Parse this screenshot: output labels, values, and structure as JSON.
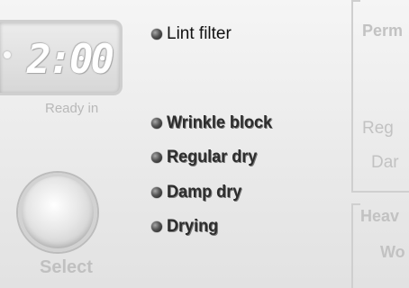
{
  "display": {
    "time": "2:00",
    "caption": "Ready in"
  },
  "select": {
    "label": "Select"
  },
  "indicators": {
    "lint_filter": "Lint filter",
    "wrinkle_block": "Wrinkle block",
    "regular_dry": "Regular dry",
    "damp_dry": "Damp dry",
    "drying": "Drying"
  },
  "cycles": {
    "perm_header": "Perm",
    "reg_option": "Reg",
    "dam_option": "Dar",
    "heavy_header": "Heav",
    "wo_option": "Wo"
  },
  "colors": {
    "indicator_light": "#444444",
    "panel_text": "#c2c2c2"
  }
}
